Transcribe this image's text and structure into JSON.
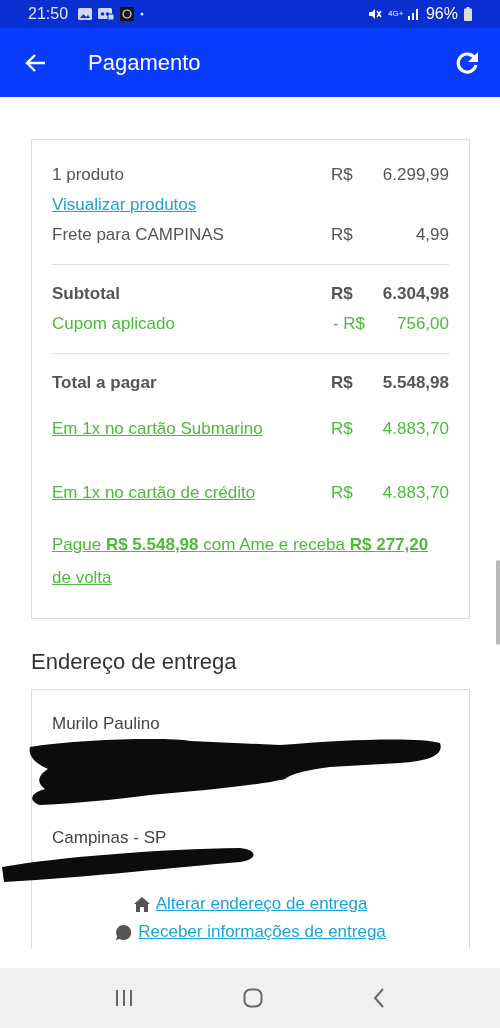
{
  "status_bar": {
    "time": "21:50",
    "network": "4G+",
    "battery": "96%"
  },
  "app_bar": {
    "title": "Pagamento"
  },
  "summary": [
    {
      "kind": "plain",
      "label": "1 produto",
      "currency": "R$",
      "amount": "6.299,99"
    },
    {
      "kind": "link",
      "label": "Visualizar produtos"
    },
    {
      "kind": "plain",
      "label": "Frete para CAMPINAS",
      "currency": "R$",
      "amount": "4,99"
    },
    {
      "kind": "divider"
    },
    {
      "kind": "bold",
      "label": "Subtotal",
      "currency": "R$",
      "amount": "6.304,98"
    },
    {
      "kind": "discount",
      "label": "Cupom aplicado",
      "currency": "- R$",
      "amount": "756,00"
    },
    {
      "kind": "divider"
    },
    {
      "kind": "bold",
      "label": "Total a pagar",
      "currency": "R$",
      "amount": "5.548,98"
    },
    {
      "kind": "installment",
      "label": "Em 1x no cartão Submarino",
      "currency": "R$",
      "amount": "4.883,70"
    },
    {
      "kind": "installment",
      "label": "Em 1x no cartão de crédito",
      "currency": "R$",
      "amount": "4.883,70"
    },
    {
      "kind": "promo",
      "label": "Pague **R$ 5.548,98** com Ame e receba **R$ 277,20** de volta"
    }
  ],
  "delivery": {
    "heading": "Endereço de entrega",
    "name": "Murilo Paulino",
    "city": "Campinas - SP",
    "links": [
      {
        "kind": "home",
        "label": "Alterar endereço de entrega"
      },
      {
        "kind": "chat",
        "label": "Receber informações de entrega"
      }
    ]
  }
}
